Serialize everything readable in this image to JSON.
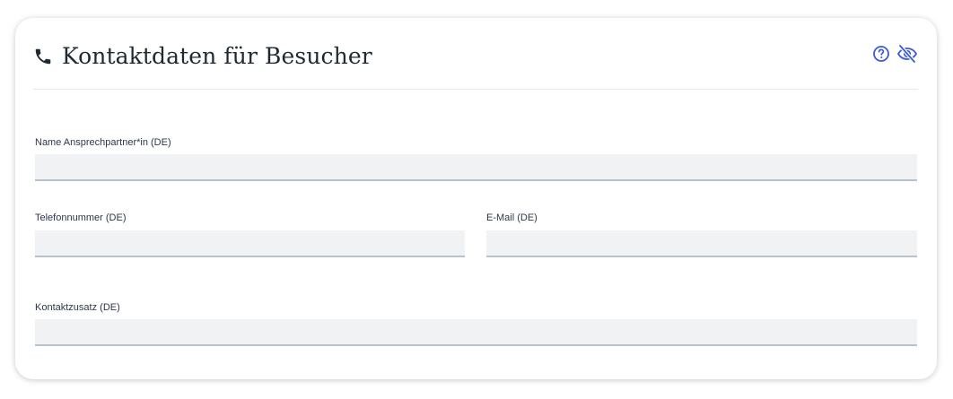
{
  "section": {
    "title": "Kontaktdaten für Besucher",
    "icons": {
      "section_icon": "phone-icon",
      "help": "help-circle-icon",
      "visibility": "eye-off-icon"
    },
    "accent_color": "#3b5bdb"
  },
  "fields": {
    "name": {
      "label": "Name Ansprechpartner*in (DE)",
      "value": ""
    },
    "phone": {
      "label": "Telefonnummer (DE)",
      "value": ""
    },
    "email": {
      "label": "E-Mail (DE)",
      "value": ""
    },
    "extra": {
      "label": "Kontaktzusatz (DE)",
      "value": ""
    }
  }
}
